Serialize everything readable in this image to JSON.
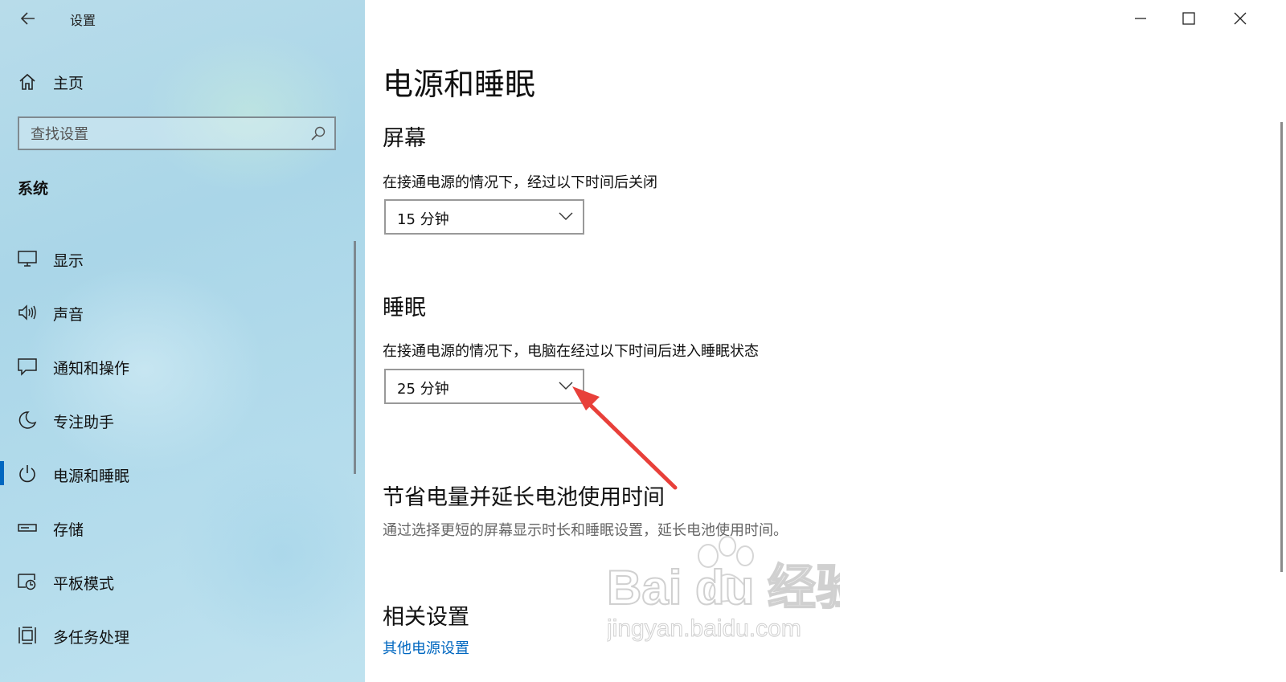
{
  "window": {
    "title": "设置",
    "controls": [
      "minimize",
      "maximize",
      "close"
    ]
  },
  "sidebar": {
    "home_label": "主页",
    "search_placeholder": "查找设置",
    "section_title": "系统",
    "items": [
      {
        "label": "显示",
        "icon": "monitor-icon"
      },
      {
        "label": "声音",
        "icon": "speaker-icon"
      },
      {
        "label": "通知和操作",
        "icon": "notification-icon"
      },
      {
        "label": "专注助手",
        "icon": "moon-icon"
      },
      {
        "label": "电源和睡眠",
        "icon": "power-icon",
        "active": true
      },
      {
        "label": "存储",
        "icon": "storage-icon"
      },
      {
        "label": "平板模式",
        "icon": "tablet-mode-icon"
      },
      {
        "label": "多任务处理",
        "icon": "multitasking-icon"
      }
    ]
  },
  "main": {
    "page_title": "电源和睡眠",
    "screen": {
      "heading": "屏幕",
      "description": "在接通电源的情况下，经过以下时间后关闭",
      "value": "15 分钟"
    },
    "sleep": {
      "heading": "睡眠",
      "description": "在接通电源的情况下，电脑在经过以下时间后进入睡眠状态",
      "value": "25 分钟"
    },
    "battery": {
      "heading": "节省电量并延长电池使用时间",
      "description": "通过选择更短的屏幕显示时长和睡眠设置，延长电池使用时间。"
    },
    "related": {
      "heading": "相关设置",
      "link": "其他电源设置"
    }
  },
  "watermark": {
    "brand": "Bai du 经验",
    "url": "jingyan.baidu.com"
  },
  "colors": {
    "accent": "#0067c0",
    "annotation_arrow": "#e8403a"
  }
}
